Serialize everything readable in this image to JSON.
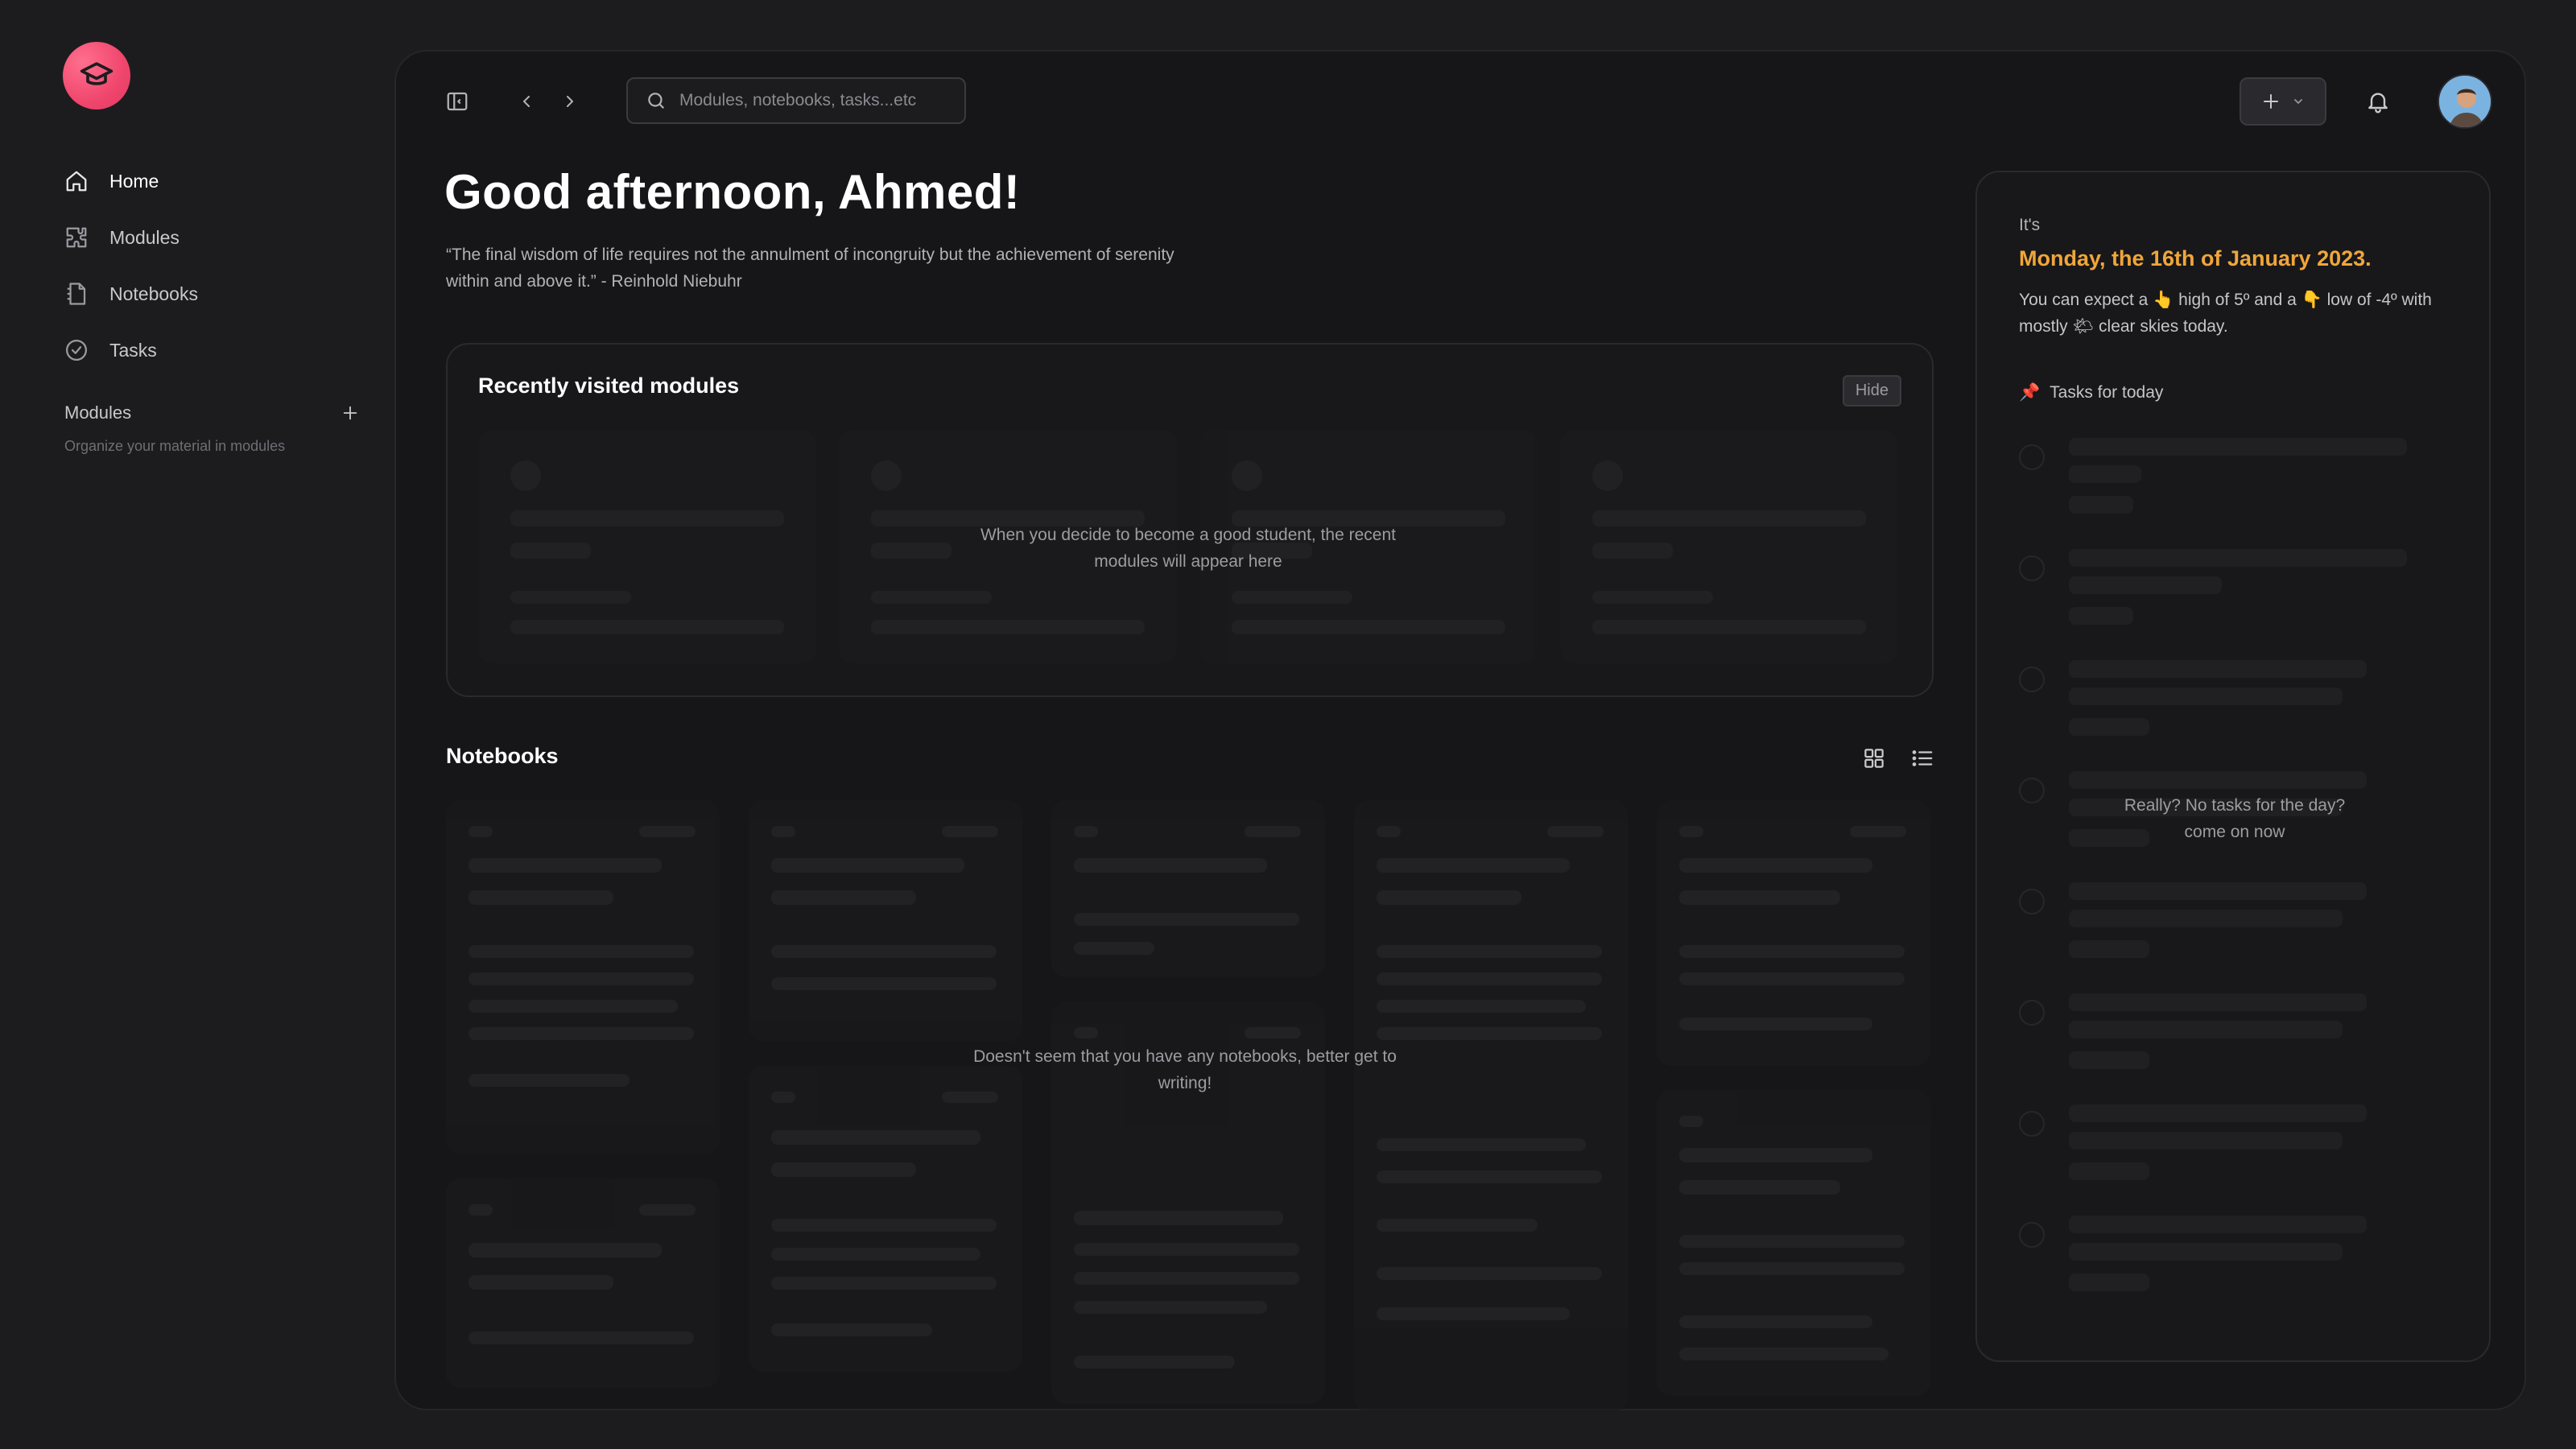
{
  "sidebar": {
    "nav": [
      {
        "label": "Home",
        "icon": "home-icon",
        "active": true
      },
      {
        "label": "Modules",
        "icon": "puzzle-icon",
        "active": false
      },
      {
        "label": "Notebooks",
        "icon": "notebook-icon",
        "active": false
      },
      {
        "label": "Tasks",
        "icon": "check-circle-icon",
        "active": false
      }
    ],
    "modules_heading": "Modules",
    "modules_subtitle": "Organize your material in modules"
  },
  "topbar": {
    "search_placeholder": "Modules, notebooks, tasks...etc"
  },
  "main": {
    "greeting": "Good afternoon, Ahmed!",
    "quote": "“The final wisdom of life requires not the annulment of incongruity but the achievement of serenity within and above it.” - Reinhold Niebuhr",
    "recent": {
      "title": "Recently visited modules",
      "hide_label": "Hide",
      "empty_message": "When you decide to become a good student, the recent modules will appear here"
    },
    "notebooks": {
      "title": "Notebooks",
      "empty_message": "Doesn't seem that you have any notebooks, better get to writing!"
    }
  },
  "right_panel": {
    "intro": "It's",
    "date": "Monday, the 16th of January 2023.",
    "weather": {
      "part1": "You can expect a ",
      "high_emoji": "👆",
      "part2": " high of 5º and a ",
      "low_emoji": "👇",
      "part3": " low of -4º with mostly ",
      "sky_emoji": "🌤",
      "part4": " clear skies today."
    },
    "tasks_icon": "📌",
    "tasks_heading": "Tasks for today",
    "tasks_empty": "Really? No tasks for the day? come on now"
  },
  "colors": {
    "accent_orange": "#f0a63a",
    "logo_pink": "#f0466d",
    "background": "#1c1c1f"
  }
}
